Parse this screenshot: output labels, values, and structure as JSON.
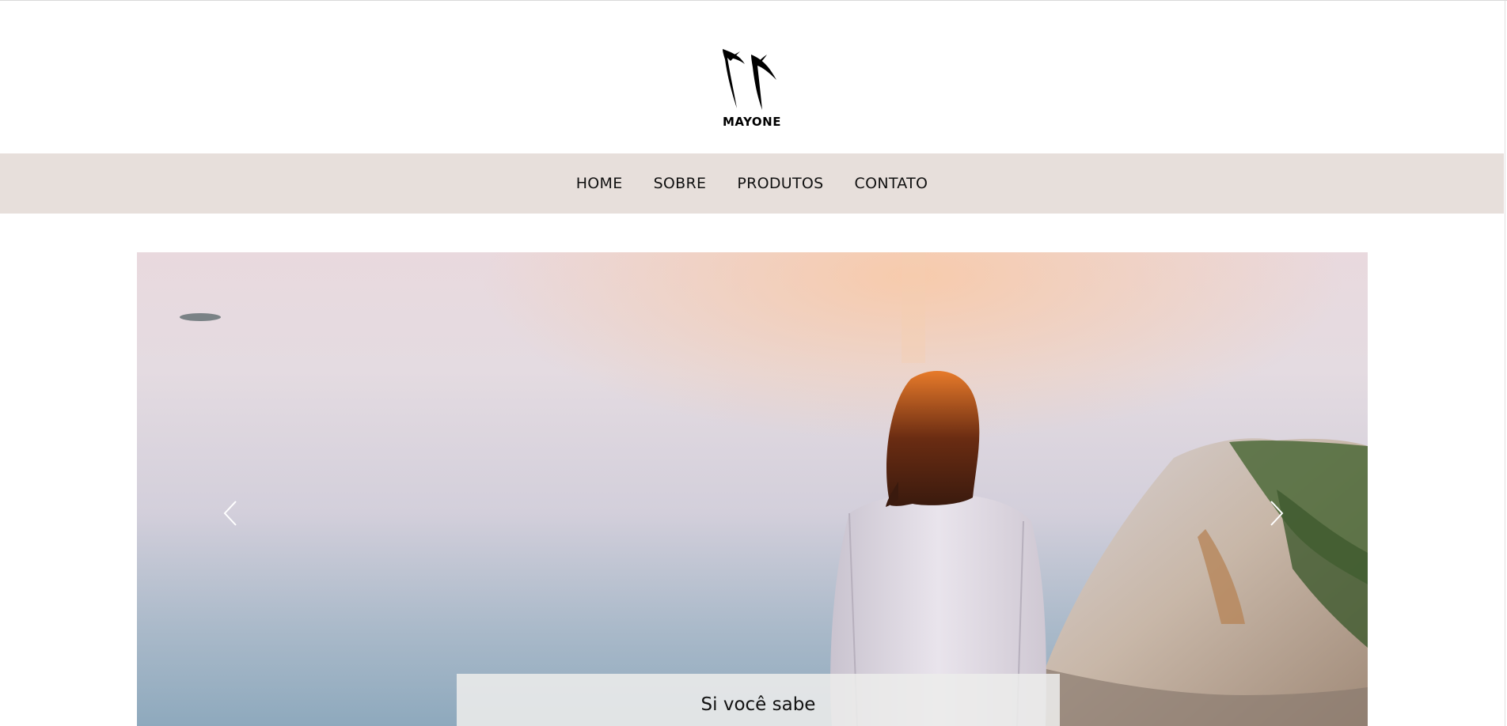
{
  "brand": {
    "logo_text": "MAYONE"
  },
  "nav": {
    "items": [
      {
        "label": "HOME"
      },
      {
        "label": "SOBRE"
      },
      {
        "label": "PRODUTOS"
      },
      {
        "label": "CONTATO"
      }
    ]
  },
  "carousel": {
    "caption_title": "Si você sabe",
    "prev_icon": "chevron-left-icon",
    "next_icon": "chevron-right-icon"
  },
  "colors": {
    "nav_background": "#e7dfdb",
    "caption_background": "#ecece9"
  }
}
